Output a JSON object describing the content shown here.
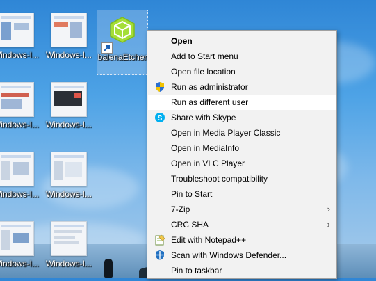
{
  "desktop": {
    "icons": [
      {
        "label": "Windows-I..."
      },
      {
        "label": "Windows-I..."
      },
      {
        "label": "balenaEtcher"
      },
      {
        "label": "Windows-I..."
      },
      {
        "label": "Windows-I..."
      },
      {
        "label": "Windows-I..."
      },
      {
        "label": "Windows-I..."
      },
      {
        "label": "Windows-I..."
      },
      {
        "label": "Windows-I..."
      }
    ]
  },
  "context_menu": {
    "items": [
      {
        "label": "Open",
        "bold": true,
        "icon": ""
      },
      {
        "label": "Add to Start menu",
        "icon": ""
      },
      {
        "label": "Open file location",
        "icon": ""
      },
      {
        "label": "Run as administrator",
        "icon": "uac-shield-icon"
      },
      {
        "label": "Run as different user",
        "icon": "",
        "highlighted": true
      },
      {
        "label": "Share with Skype",
        "icon": "skype-icon"
      },
      {
        "label": "Open in Media Player Classic",
        "icon": ""
      },
      {
        "label": "Open in MediaInfo",
        "icon": ""
      },
      {
        "label": "Open in VLC Player",
        "icon": ""
      },
      {
        "label": "Troubleshoot compatibility",
        "icon": ""
      },
      {
        "label": "Pin to Start",
        "icon": ""
      },
      {
        "label": "7-Zip",
        "icon": "",
        "submenu": true
      },
      {
        "label": "CRC SHA",
        "icon": "",
        "submenu": true
      },
      {
        "label": "Edit with Notepad++",
        "icon": "notepadpp-icon"
      },
      {
        "label": "Scan with Windows Defender...",
        "icon": "defender-icon"
      },
      {
        "label": "Pin to taskbar",
        "icon": ""
      }
    ],
    "submenu_arrow": "›"
  },
  "colors": {
    "menu_bg": "#f2f2f2",
    "menu_hover": "#ffffff",
    "etcher_green": "#a5de37"
  }
}
